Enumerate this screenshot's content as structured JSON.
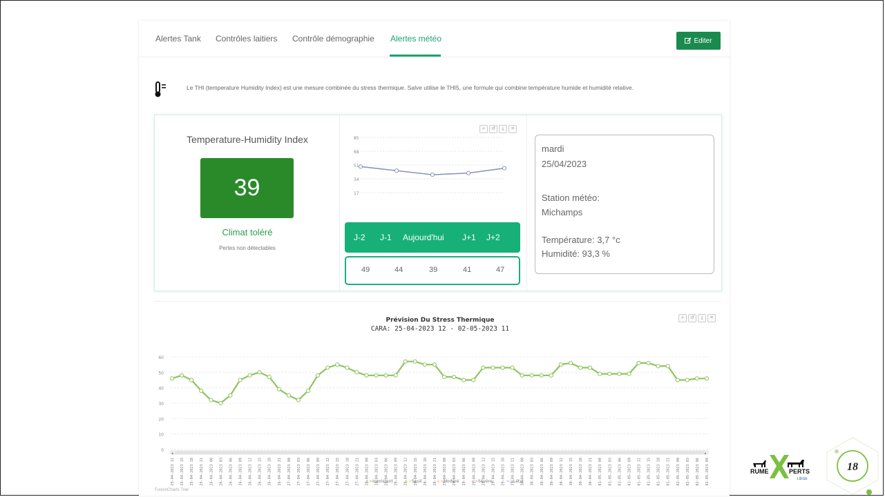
{
  "tabs": [
    {
      "label": "Alertes Tank",
      "active": false
    },
    {
      "label": "Contrôles laitiers",
      "active": false
    },
    {
      "label": "Contrôle démographie",
      "active": false
    },
    {
      "label": "Alertes météo",
      "active": true
    }
  ],
  "edit_button": {
    "label": "Editer"
  },
  "info_text": "Le THI (temperature Humidity Index) est une mesure combinée du stress thermique. Salve utilise le THI5, une formule qui combine température humide et humidité relative.",
  "thi": {
    "title": "Temperature-Humidity Index",
    "value": "39",
    "climate": "Climat toléré",
    "losses": "Pertes non détectables"
  },
  "days": [
    "J-2",
    "J-1",
    "Aujourd'hui",
    "J+1",
    "J+2"
  ],
  "day_values": [
    "49",
    "44",
    "39",
    "41",
    "47"
  ],
  "meteo": {
    "day": "mardi",
    "date": "25/04/2023",
    "station_label": "Station météo:",
    "station": "Michamps",
    "temperature": "Température: 3,7 °c",
    "humidity": "Humidité: 93,3 %"
  },
  "forecast": {
    "title": "Prévision Du Stress Thermique",
    "subtitle": "CARA: 25-04-2023 12 - 02-05-2023 11",
    "legend": [
      "Inexistant",
      "Seuil",
      "Modéré",
      "Sévère",
      "Létal"
    ],
    "watermark": "FusionCharts Trial"
  },
  "colors": {
    "accent": "#17b078",
    "thi_box": "#2a8a2a",
    "mini_line": "#8a93b8",
    "forecast_line": "#8fc360",
    "legend_inexistant": "#8fc360",
    "legend_seuil": "#e6c84a",
    "legend_modere": "#f0a868",
    "legend_severe": "#c78fb0",
    "legend_letal": "#a89bc8"
  },
  "page_number": "18",
  "chart_data": [
    {
      "type": "line",
      "title": "",
      "categories": [
        "J-2",
        "J-1",
        "Aujourd'hui",
        "J+1",
        "J+2"
      ],
      "values": [
        49,
        44,
        39,
        41,
        47
      ],
      "ylim": [
        0,
        85
      ],
      "yticks": [
        17,
        34,
        51,
        68,
        85
      ],
      "grid": true
    },
    {
      "type": "line",
      "title": "Prévision Du Stress Thermique",
      "subtitle": "CARA: 25-04-2023 12 - 02-05-2023 11",
      "ylim": [
        0,
        60
      ],
      "yticks": [
        0,
        10,
        20,
        30,
        40,
        50,
        60
      ],
      "grid": true,
      "legend_position": "bottom",
      "categories": [
        "25-04-2023 12",
        "25-04-2023 15",
        "25-04-2023 18",
        "25-04-2023 21",
        "26-04-2023 00",
        "26-04-2023 03",
        "26-04-2023 06",
        "26-04-2023 09",
        "26-04-2023 12",
        "26-04-2023 15",
        "26-04-2023 18",
        "26-04-2023 21",
        "27-04-2023 00",
        "27-04-2023 03",
        "27-04-2023 06",
        "27-04-2023 09",
        "27-04-2023 12",
        "27-04-2023 15",
        "27-04-2023 18",
        "27-04-2023 21",
        "28-04-2023 00",
        "28-04-2023 03",
        "28-04-2023 06",
        "28-04-2023 09",
        "28-04-2023 12",
        "28-04-2023 15",
        "28-04-2023 18",
        "28-04-2023 21",
        "29-04-2023 00",
        "29-04-2023 03",
        "29-04-2023 06",
        "29-04-2023 09",
        "29-04-2023 12",
        "29-04-2023 15",
        "29-04-2023 18",
        "29-04-2023 21",
        "30-04-2023 00",
        "30-04-2023 03",
        "30-04-2023 06",
        "30-04-2023 09",
        "30-04-2023 12",
        "30-04-2023 15",
        "30-04-2023 18",
        "30-04-2023 21",
        "01-05-2023 00",
        "01-05-2023 03",
        "01-05-2023 06",
        "01-05-2023 09",
        "01-05-2023 12",
        "01-05-2023 15",
        "01-05-2023 18",
        "01-05-2023 21",
        "02-05-2023 00",
        "02-05-2023 03",
        "02-05-2023 06",
        "02-05-2023 09"
      ],
      "series": [
        {
          "values": [
            46,
            48,
            45,
            38,
            32,
            30,
            35,
            45,
            48,
            50,
            47,
            39,
            35,
            32,
            38,
            48,
            53,
            55,
            53,
            50,
            48,
            48,
            48,
            48,
            57,
            57,
            55,
            55,
            47,
            47,
            45,
            45,
            53,
            53,
            53,
            53,
            48,
            48,
            48,
            48,
            55,
            56,
            53,
            53,
            49,
            49,
            49,
            49,
            56,
            56,
            54,
            54,
            45,
            45,
            46,
            46
          ]
        }
      ]
    }
  ]
}
